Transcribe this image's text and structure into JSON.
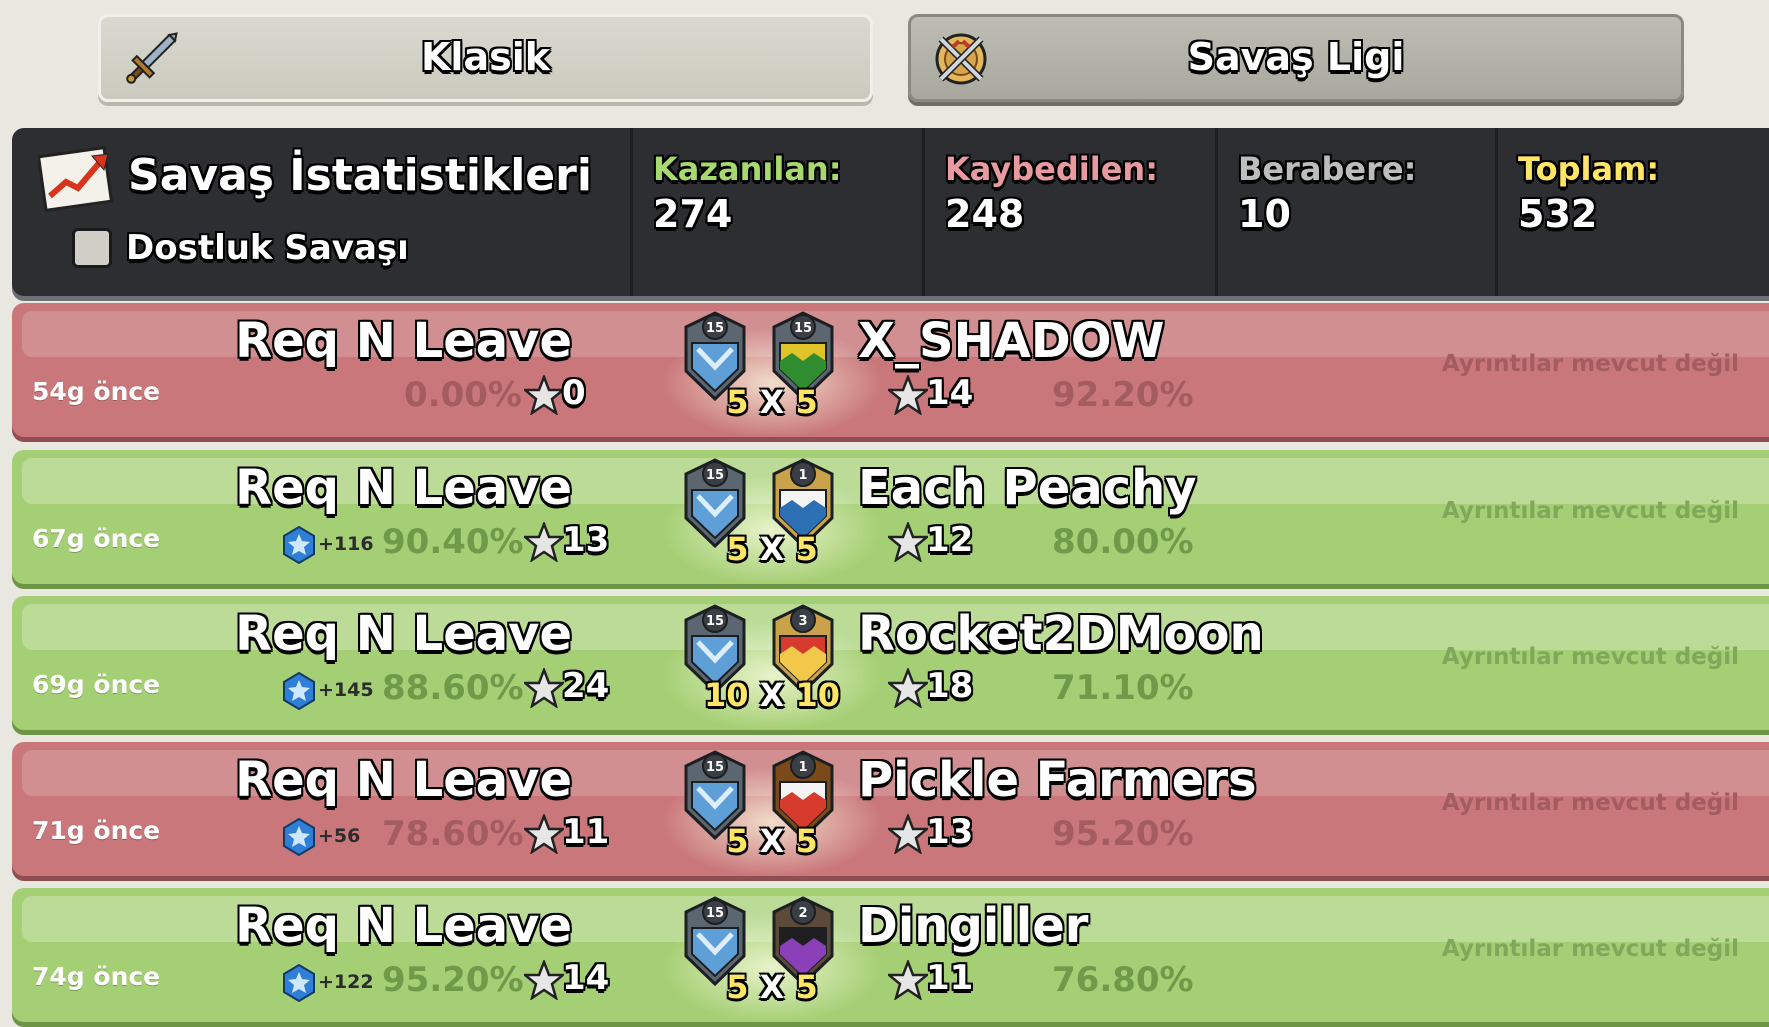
{
  "tabs": {
    "classic_label": "Klasik",
    "league_label": "Savaş Ligi"
  },
  "stats": {
    "title": "Savaş İstatistikleri",
    "friendly_label": "Dostluk Savaşı",
    "won_label": "Kazanılan:",
    "won_value": "274",
    "lost_label": "Kaybedilen:",
    "lost_value": "248",
    "draw_label": "Berabere:",
    "draw_value": "10",
    "total_label": "Toplam:",
    "total_value": "532"
  },
  "colors": {
    "loss_row": "#c9777a",
    "win_row": "#a5cf74",
    "won_label": "#a8d96f",
    "lost_label": "#e89aa0",
    "draw_label": "#bdbdbd",
    "total_label": "#ffe566"
  },
  "wars": [
    {
      "result": "loss",
      "ago": "54g önce",
      "trophies": "",
      "our_clan": "Req N Leave",
      "our_level": "15",
      "our_pct": "0.00%",
      "our_stars": "0",
      "size_a": "5",
      "size_x": "X",
      "size_b": "5",
      "enemy_clan": "X_SHADOW",
      "enemy_level": "15",
      "enemy_stars": "14",
      "enemy_pct": "92.20%",
      "details": "Ayrıntılar mevcut değil"
    },
    {
      "result": "win",
      "ago": "67g önce",
      "trophies": "+116",
      "our_clan": "Req N Leave",
      "our_level": "15",
      "our_pct": "90.40%",
      "our_stars": "13",
      "size_a": "5",
      "size_x": "X",
      "size_b": "5",
      "enemy_clan": "Each Peachy",
      "enemy_level": "1",
      "enemy_stars": "12",
      "enemy_pct": "80.00%",
      "details": "Ayrıntılar mevcut değil"
    },
    {
      "result": "win",
      "ago": "69g önce",
      "trophies": "+145",
      "our_clan": "Req N Leave",
      "our_level": "15",
      "our_pct": "88.60%",
      "our_stars": "24",
      "size_a": "10",
      "size_x": "X",
      "size_b": "10",
      "enemy_clan": "Rocket2DMoon",
      "enemy_level": "3",
      "enemy_stars": "18",
      "enemy_pct": "71.10%",
      "details": "Ayrıntılar mevcut değil"
    },
    {
      "result": "loss",
      "ago": "71g önce",
      "trophies": "+56",
      "our_clan": "Req N Leave",
      "our_level": "15",
      "our_pct": "78.60%",
      "our_stars": "11",
      "size_a": "5",
      "size_x": "X",
      "size_b": "5",
      "enemy_clan": "Pickle Farmers",
      "enemy_level": "1",
      "enemy_stars": "13",
      "enemy_pct": "95.20%",
      "details": "Ayrıntılar mevcut değil"
    },
    {
      "result": "win",
      "ago": "74g önce",
      "trophies": "+122",
      "our_clan": "Req N Leave",
      "our_level": "15",
      "our_pct": "95.20%",
      "our_stars": "14",
      "size_a": "5",
      "size_x": "X",
      "size_b": "5",
      "enemy_clan": "Dingiller",
      "enemy_level": "2",
      "enemy_stars": "11",
      "enemy_pct": "76.80%",
      "details": "Ayrıntılar mevcut değil"
    }
  ]
}
